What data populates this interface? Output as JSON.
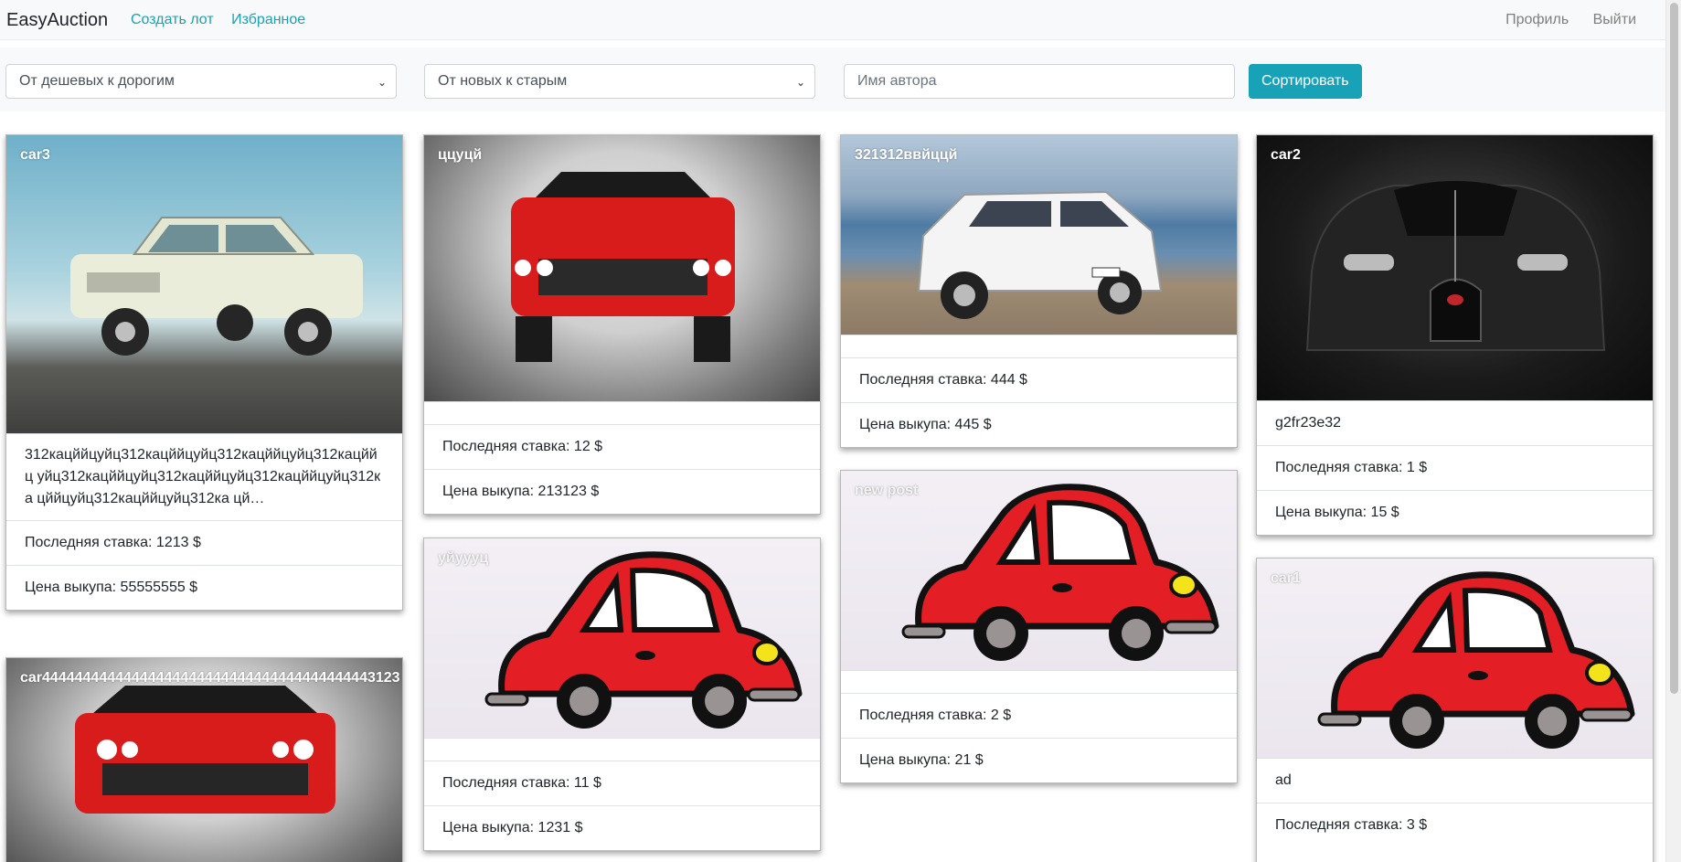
{
  "app": {
    "brand": "EasyAuction"
  },
  "nav": {
    "create_lot": "Создать лот",
    "favorites": "Избранное",
    "profile": "Профиль",
    "logout": "Выйти"
  },
  "filters": {
    "price_sort": "От дешевых к дорогим",
    "date_sort": "От новых к старым",
    "author_placeholder": "Имя автора",
    "sort_button": "Сортировать"
  },
  "labels": {
    "last_bid": "Последняя ставка:",
    "buyout": "Цена выкупа:",
    "currency": "$"
  },
  "cards": [
    {
      "title": "car3",
      "description": "312кацййцуйц312кацййцуйц312кацййцуйц312кацйй ц уйц312кацййцуйц312кацййцуйц312кацййцуйц312ка цййцуйц312кацййцуйц312ка цй…",
      "last_bid": "Последняя ставка: 1213 $",
      "buyout": "Цена выкупа: 55555555 $"
    },
    {
      "title": "ццуцй",
      "last_bid": "Последняя ставка: 12 $",
      "buyout": "Цена выкупа: 213123 $"
    },
    {
      "title": "321312ввйццй",
      "last_bid": "Последняя ставка: 444 $",
      "buyout": "Цена выкупа: 445 $"
    },
    {
      "title": "car2",
      "description": "g2fr23e32",
      "last_bid": "Последняя ставка: 1 $",
      "buyout": "Цена выкупа: 15 $"
    },
    {
      "title": "car44444444444444444444444444444444444444443123"
    },
    {
      "title": "уйуууц",
      "last_bid": "Последняя ставка: 11 $",
      "buyout": "Цена выкупа: 1231 $"
    },
    {
      "title": "new post",
      "last_bid": "Последняя ставка: 2 $",
      "buyout": "Цена выкупа: 21 $"
    },
    {
      "title": "car1",
      "description": "ad",
      "last_bid": "Последняя ставка: 3 $"
    }
  ]
}
